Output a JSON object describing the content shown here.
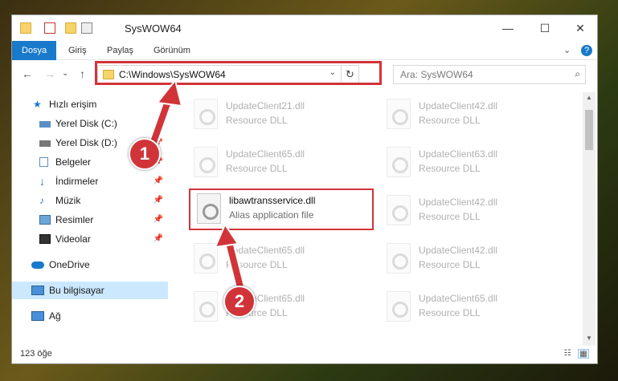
{
  "window": {
    "title": "SysWOW64",
    "minimize": "—",
    "maximize": "☐",
    "close": "✕"
  },
  "ribbon": {
    "tabs": [
      {
        "label": "Dosya"
      },
      {
        "label": "Giriş"
      },
      {
        "label": "Paylaş"
      },
      {
        "label": "Görünüm"
      }
    ],
    "collapse": "⌄",
    "help": "?"
  },
  "address": {
    "path": "C:\\Windows\\SysWOW64",
    "back": "←",
    "forward": "→",
    "recent": "⌄",
    "up": "↑",
    "dropdown": "⌄",
    "refresh": "↻"
  },
  "search": {
    "placeholder": "Ara: SysWOW64",
    "icon": "⌕"
  },
  "sidebar": {
    "items": [
      {
        "label": "Hızlı erişim",
        "icon": "star-icon"
      },
      {
        "label": "Yerel Disk (C:)",
        "icon": "drive-icon",
        "pin": "📌"
      },
      {
        "label": "Yerel Disk (D:)",
        "icon": "drive-icon",
        "pin": "📌"
      },
      {
        "label": "Belgeler",
        "icon": "documents-icon",
        "pin": "📌"
      },
      {
        "label": "İndirmeler",
        "icon": "downloads-icon",
        "pin": "📌"
      },
      {
        "label": "Müzik",
        "icon": "music-icon",
        "pin": "📌"
      },
      {
        "label": "Resimler",
        "icon": "pictures-icon",
        "pin": "📌"
      },
      {
        "label": "Videolar",
        "icon": "videos-icon",
        "pin": "📌"
      },
      {
        "label": "OneDrive",
        "icon": "cloud-icon"
      },
      {
        "label": "Bu bilgisayar",
        "icon": "computer-icon"
      },
      {
        "label": "Ağ",
        "icon": "network-icon"
      }
    ]
  },
  "files": [
    {
      "name": "UpdateClient21.dll",
      "desc": "Resource DLL"
    },
    {
      "name": "UpdateClient42.dll",
      "desc": "Resource DLL"
    },
    {
      "name": "UpdateClient65.dll",
      "desc": "Resource DLL"
    },
    {
      "name": "UpdateClient63.dll",
      "desc": "Resource DLL"
    },
    {
      "name": "libawtransservice.dll",
      "desc": "Alias application file"
    },
    {
      "name": "UpdateClient42.dll",
      "desc": "Resource DLL"
    },
    {
      "name": "UpdateClient65.dll",
      "desc": "Resource DLL"
    },
    {
      "name": "UpdateClient42.dll",
      "desc": "Resource DLL"
    },
    {
      "name": "UpdateClient65.dll",
      "desc": "Resource DLL"
    },
    {
      "name": "UpdateClient65.dll",
      "desc": "Resource DLL"
    }
  ],
  "status": {
    "count": "123 öğe",
    "details_view": "☷",
    "tiles_view": "▦"
  },
  "scroll": {
    "up": "▲",
    "down": "▼"
  },
  "annotations": {
    "step1": "1",
    "step2": "2"
  },
  "colors": {
    "accent": "#1979ca",
    "highlight": "#d13438",
    "selected": "#cce8ff"
  }
}
